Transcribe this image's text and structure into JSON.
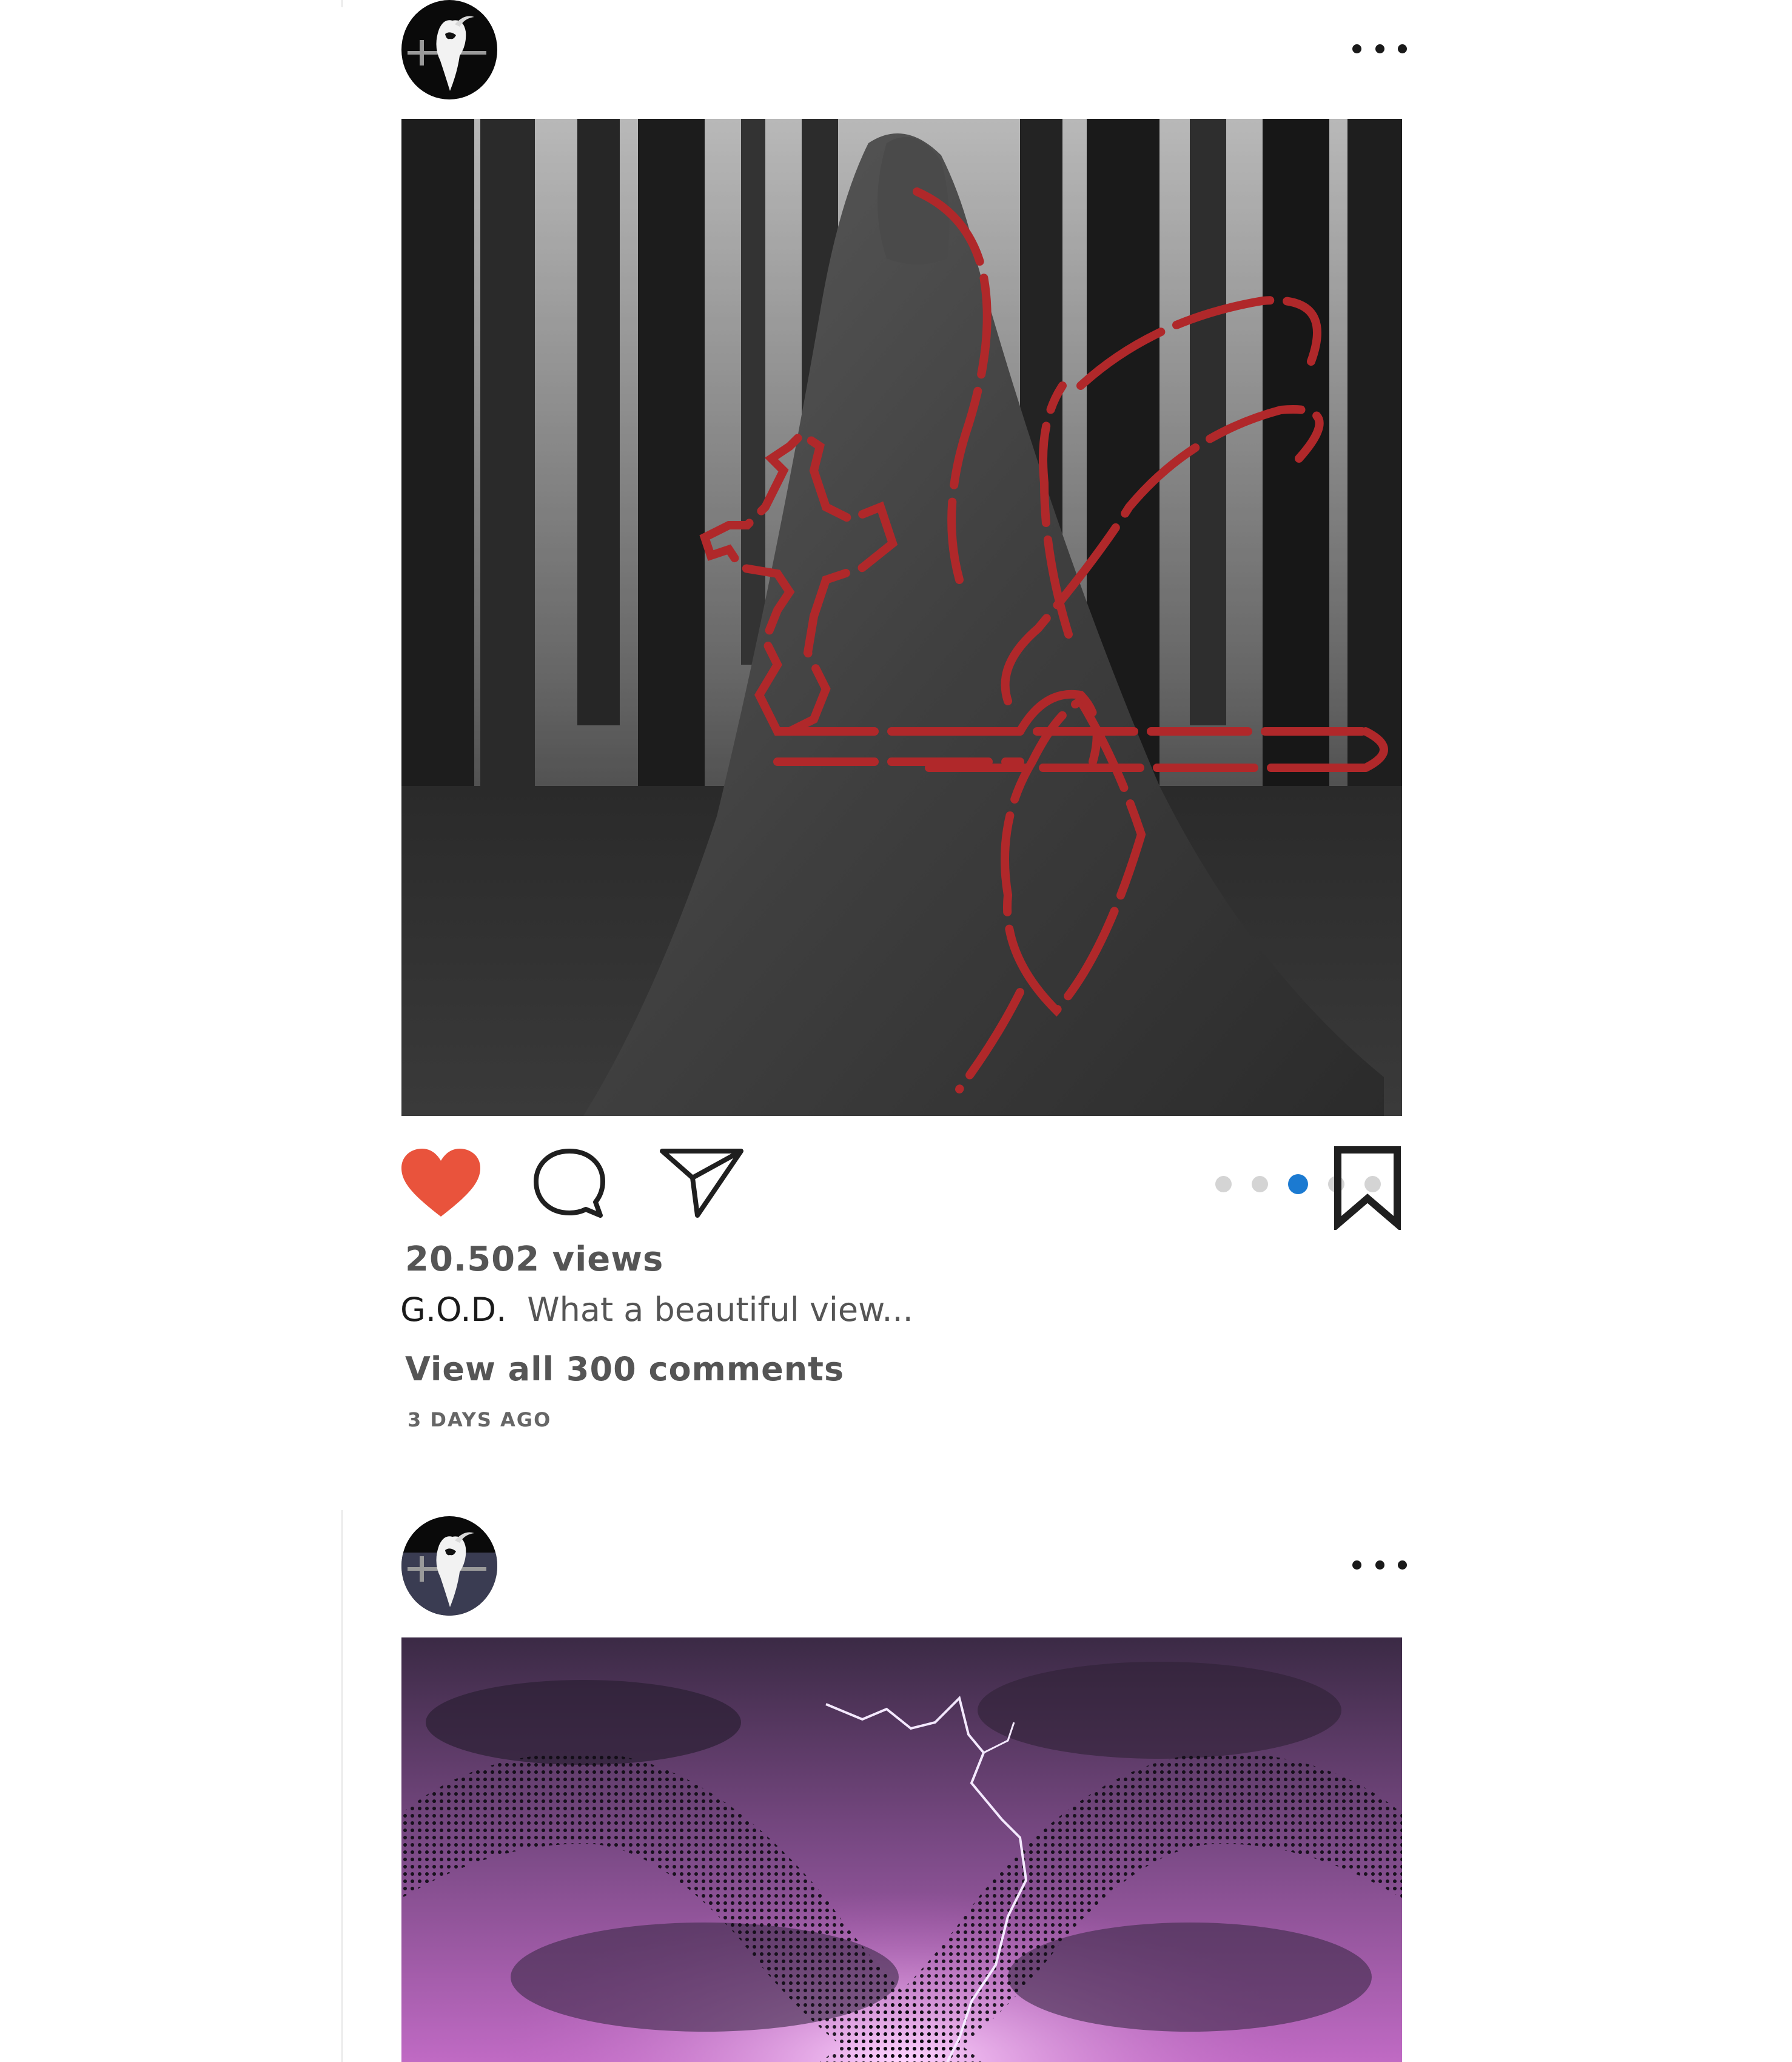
{
  "colors": {
    "like": "#e9533c",
    "active_dot": "#1b7ad1",
    "inactive_dot": "#d4d4d4",
    "secondary_text": "#555555",
    "timestamp_text": "#666666",
    "icon_stroke": "#1f1f1f"
  },
  "feed": {
    "post1": {
      "avatar_icon": "inverted-cross-goat-logo-icon",
      "more_icon": "more-options-icon",
      "media_description_icon": "hooded-figure-forest-image",
      "actions": {
        "like_icon": "heart-filled-icon",
        "comment_icon": "speech-bubble-icon",
        "share_icon": "paper-plane-icon",
        "save_icon": "bookmark-icon"
      },
      "carousel": {
        "count": 5,
        "active_index": 2
      },
      "views": "20.502 views",
      "username": "G.O.D.",
      "caption": "What a beautiful view...",
      "comments_link": "View all 300 comments",
      "timestamp": "3 DAYS AGO"
    },
    "post2": {
      "avatar_icon": "inverted-cross-goat-logo-icon",
      "more_icon": "more-options-icon",
      "media_description_icon": "infinity-lightning-image"
    }
  }
}
